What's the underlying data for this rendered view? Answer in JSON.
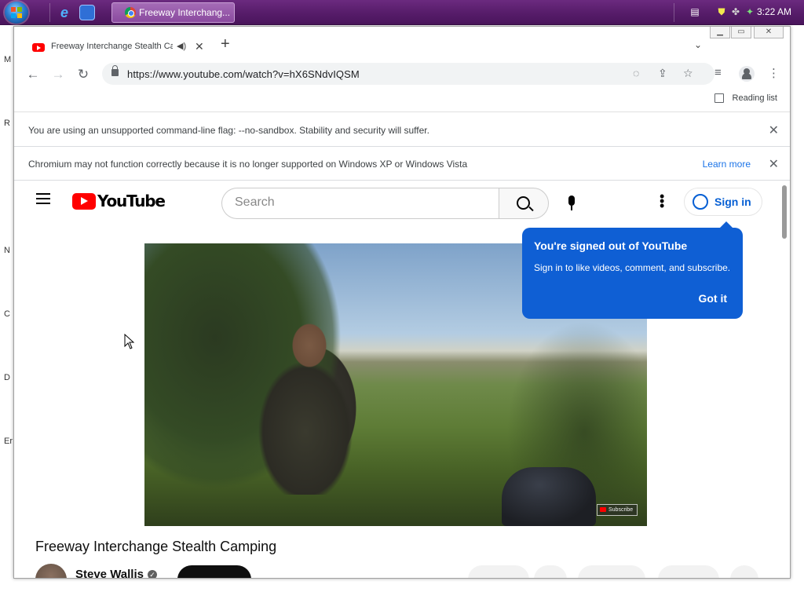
{
  "taskbar": {
    "task_button_label": "Freeway Interchang...",
    "clock": "3:22 AM"
  },
  "desktop": {
    "edge_letters": [
      "M",
      "R",
      "N",
      "C",
      "D",
      "Er"
    ]
  },
  "browser": {
    "tab_title": "Freeway Interchange Stealth Ca",
    "url": "https://www.youtube.com/watch?v=hX6SNdvIQSM",
    "reading_list_label": "Reading list",
    "infobars": [
      {
        "message": "You are using an unsupported command-line flag: --no-sandbox. Stability and security will suffer."
      },
      {
        "message": "Chromium may not function correctly because it is no longer supported on Windows XP or Windows Vista",
        "link": "Learn more"
      }
    ]
  },
  "youtube": {
    "logo_text": "YouTube",
    "search_placeholder": "Search",
    "signin_label": "Sign in",
    "popup": {
      "title": "You're signed out of YouTube",
      "body": "Sign in to like videos, comment, and subscribe.",
      "button": "Got it"
    },
    "video_watermark": "Subscribe",
    "video_title": "Freeway Interchange Stealth Camping",
    "channel_name": "Steve Wallis"
  },
  "icons": {
    "start": "windows-orb-icon",
    "tab_favicon": "youtube-favicon-icon",
    "audio": "speaker-icon",
    "verified": "checkmark-icon"
  },
  "colors": {
    "taskbar": "#561c69",
    "youtube_red": "#ff0000",
    "youtube_blue": "#065fd4",
    "popup_bg": "#0f5fd4",
    "link_blue": "#1a73e8"
  }
}
